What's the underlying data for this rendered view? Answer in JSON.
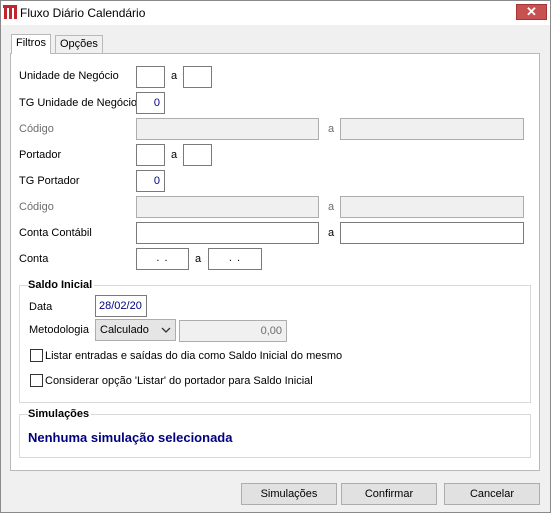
{
  "window": {
    "title": "Fluxo Diário Calendário",
    "close_label": "✕"
  },
  "tabs": [
    {
      "label": "Filtros"
    },
    {
      "label": "Opções"
    }
  ],
  "filters": {
    "unidade_negocio": {
      "label": "Unidade de Negócio",
      "sep": "a",
      "from": "",
      "to": ""
    },
    "tg_unidade_negocio": {
      "label": "TG Unidade de Negócio",
      "value": "0"
    },
    "codigo1": {
      "label": "Código",
      "sep": "a",
      "from": "",
      "to": ""
    },
    "portador": {
      "label": "Portador",
      "sep": "a",
      "from": "",
      "to": ""
    },
    "tg_portador": {
      "label": "TG Portador",
      "value": "0"
    },
    "codigo2": {
      "label": "Código",
      "sep": "a",
      "from": "",
      "to": ""
    },
    "conta_contabil": {
      "label": "Conta Contábil",
      "sep": "a",
      "from": "",
      "to": ""
    },
    "conta": {
      "label": "Conta",
      "sep": "a",
      "from": ". .",
      "to": ". ."
    }
  },
  "saldo_inicial": {
    "title": "Saldo Inicial",
    "data_label": "Data",
    "data_value": "28/02/20",
    "metodologia_label": "Metodologia",
    "metodologia_value": "Calculado",
    "metodologia_amount": "0,00",
    "checkbox1": "Listar entradas e saídas do dia como Saldo Inicial do mesmo",
    "checkbox2": "Considerar opção 'Listar' do portador para Saldo Inicial"
  },
  "simulacoes": {
    "title": "Simulações",
    "text": "Nenhuma simulação selecionada"
  },
  "buttons": {
    "simulacoes": "Simulações",
    "confirmar": "Confirmar",
    "cancelar": "Cancelar"
  }
}
